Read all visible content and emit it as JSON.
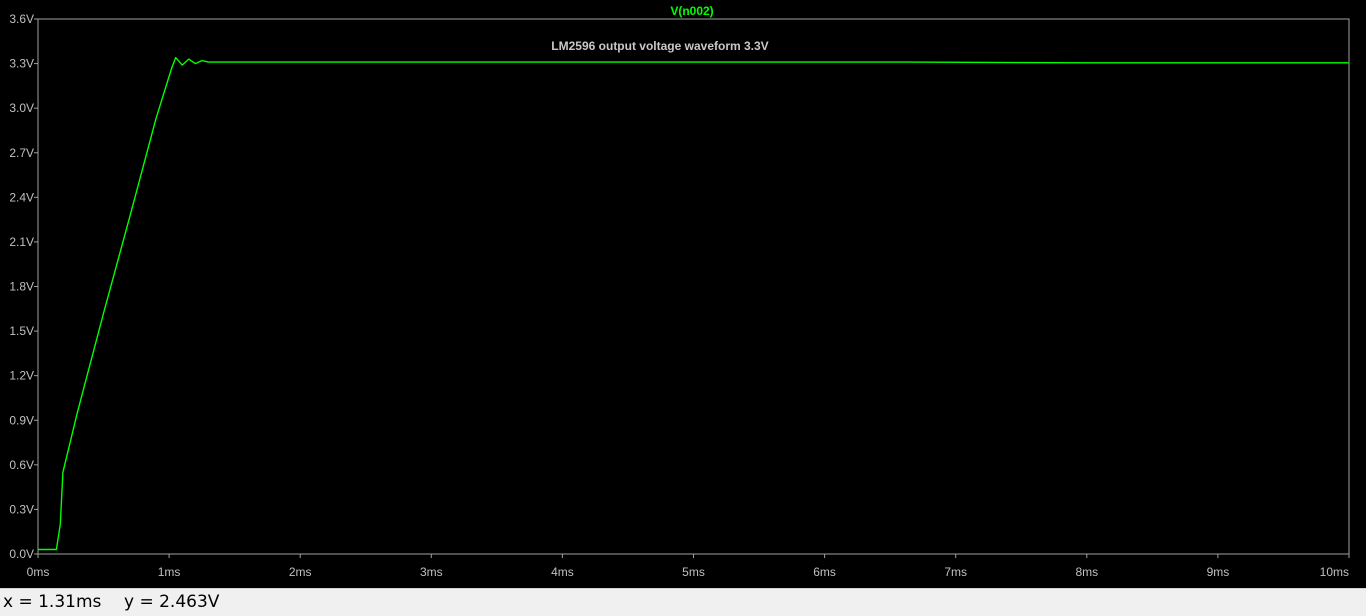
{
  "window": {
    "trace_name": "V(n002)",
    "annotation": "LM2596 output voltage waveform 3.3V"
  },
  "status": {
    "x_readout": "x = 1.31ms",
    "y_readout": "y = 2.463V"
  },
  "colors": {
    "background": "#000000",
    "trace": "#00ff00",
    "axis": "#c0c0c0",
    "status_bar": "#f0f0f0"
  },
  "chart_data": {
    "type": "line",
    "title": "V(n002)",
    "annotation": "LM2596 output voltage waveform 3.3V",
    "xlabel": "",
    "ylabel": "",
    "xlim": [
      0,
      10
    ],
    "ylim": [
      0,
      3.6
    ],
    "grid": false,
    "x_ticks": [
      "0ms",
      "1ms",
      "2ms",
      "3ms",
      "4ms",
      "5ms",
      "6ms",
      "7ms",
      "8ms",
      "9ms",
      "10ms"
    ],
    "x_tick_values": [
      0,
      1,
      2,
      3,
      4,
      5,
      6,
      7,
      8,
      9,
      10
    ],
    "y_ticks": [
      "0.0V",
      "0.3V",
      "0.6V",
      "0.9V",
      "1.2V",
      "1.5V",
      "1.8V",
      "2.1V",
      "2.4V",
      "2.7V",
      "3.0V",
      "3.3V",
      "3.6V"
    ],
    "y_tick_values": [
      0,
      0.3,
      0.6,
      0.9,
      1.2,
      1.5,
      1.8,
      2.1,
      2.4,
      2.7,
      3.0,
      3.3,
      3.6
    ],
    "series": [
      {
        "name": "V(n002)",
        "x": [
          0,
          0.14,
          0.17,
          0.19,
          0.3,
          0.5,
          0.7,
          0.9,
          1.02,
          1.05,
          1.1,
          1.15,
          1.2,
          1.25,
          1.3,
          2.0,
          4.0,
          6.0,
          6.65,
          8.0,
          10.0
        ],
        "y": [
          0.03,
          0.03,
          0.2,
          0.55,
          0.95,
          1.62,
          2.27,
          2.93,
          3.27,
          3.34,
          3.29,
          3.33,
          3.3,
          3.32,
          3.31,
          3.31,
          3.31,
          3.31,
          3.31,
          3.305,
          3.305
        ]
      }
    ]
  }
}
